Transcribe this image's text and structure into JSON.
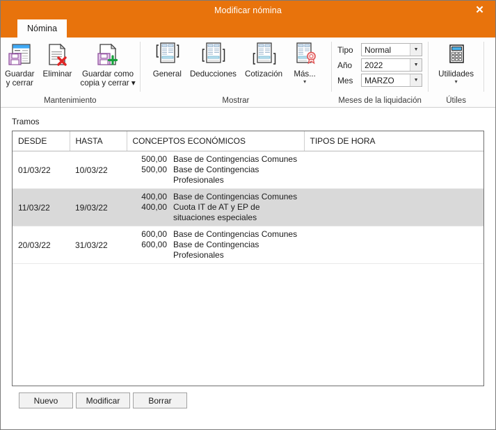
{
  "window": {
    "title": "Modificar nómina",
    "close_label": "✕",
    "accent_color": "#E8730C"
  },
  "tabs": [
    {
      "label": "Nómina",
      "active": true
    }
  ],
  "ribbon": {
    "groups": [
      {
        "name": "mantenimiento",
        "label": "Mantenimiento",
        "buttons": [
          {
            "icon": "save-and-close-icon",
            "caption": "Guardar\ny cerrar",
            "caret": false
          },
          {
            "icon": "delete-document-icon",
            "caption": "Eliminar",
            "caret": false
          },
          {
            "icon": "save-copy-icon",
            "caption": "Guardar como\ncopia y cerrar ▾",
            "caret": false
          }
        ]
      },
      {
        "name": "mostrar",
        "label": "Mostrar",
        "buttons": [
          {
            "icon": "general-document-icon",
            "caption": "General",
            "caret": false
          },
          {
            "icon": "deductions-document-icon",
            "caption": "Deducciones",
            "caret": false
          },
          {
            "icon": "contribution-document-icon",
            "caption": "Cotización",
            "caret": false
          },
          {
            "icon": "more-seal-document-icon",
            "caption": "Más...",
            "caret": true
          }
        ]
      },
      {
        "name": "meses-liquidacion",
        "label": "Meses de la liquidación",
        "fields": [
          {
            "label": "Tipo",
            "value": "Normal"
          },
          {
            "label": "Año",
            "value": "2022"
          },
          {
            "label": "Mes",
            "value": "MARZO"
          }
        ]
      },
      {
        "name": "utiles",
        "label": "Útiles",
        "buttons": [
          {
            "icon": "calculator-icon",
            "caption": "Utilidades",
            "caret": true
          }
        ]
      }
    ]
  },
  "main": {
    "section_label": "Tramos",
    "table": {
      "columns": [
        "DESDE",
        "HASTA",
        "CONCEPTOS ECONÓMICOS",
        "TIPOS DE HORA"
      ],
      "rows": [
        {
          "desde": "01/03/22",
          "hasta": "10/03/22",
          "selected": false,
          "conceptos": [
            {
              "amount": "500,00",
              "desc": "Base de Contingencias Comunes"
            },
            {
              "amount": "500,00",
              "desc": "Base de Contingencias Profesionales"
            }
          ],
          "tipos_de_hora": ""
        },
        {
          "desde": "11/03/22",
          "hasta": "19/03/22",
          "selected": true,
          "conceptos": [
            {
              "amount": "400,00",
              "desc": "Base de Contingencias Comunes"
            },
            {
              "amount": "400,00",
              "desc": "Cuota IT de AT y EP de situaciones especiales"
            }
          ],
          "tipos_de_hora": ""
        },
        {
          "desde": "20/03/22",
          "hasta": "31/03/22",
          "selected": false,
          "conceptos": [
            {
              "amount": "600,00",
              "desc": "Base de Contingencias Comunes"
            },
            {
              "amount": "600,00",
              "desc": "Base de Contingencias Profesionales"
            }
          ],
          "tipos_de_hora": ""
        }
      ]
    },
    "buttons": [
      {
        "name": "nuevo",
        "label": "Nuevo"
      },
      {
        "name": "modificar",
        "label": "Modificar"
      },
      {
        "name": "borrar",
        "label": "Borrar"
      }
    ]
  }
}
